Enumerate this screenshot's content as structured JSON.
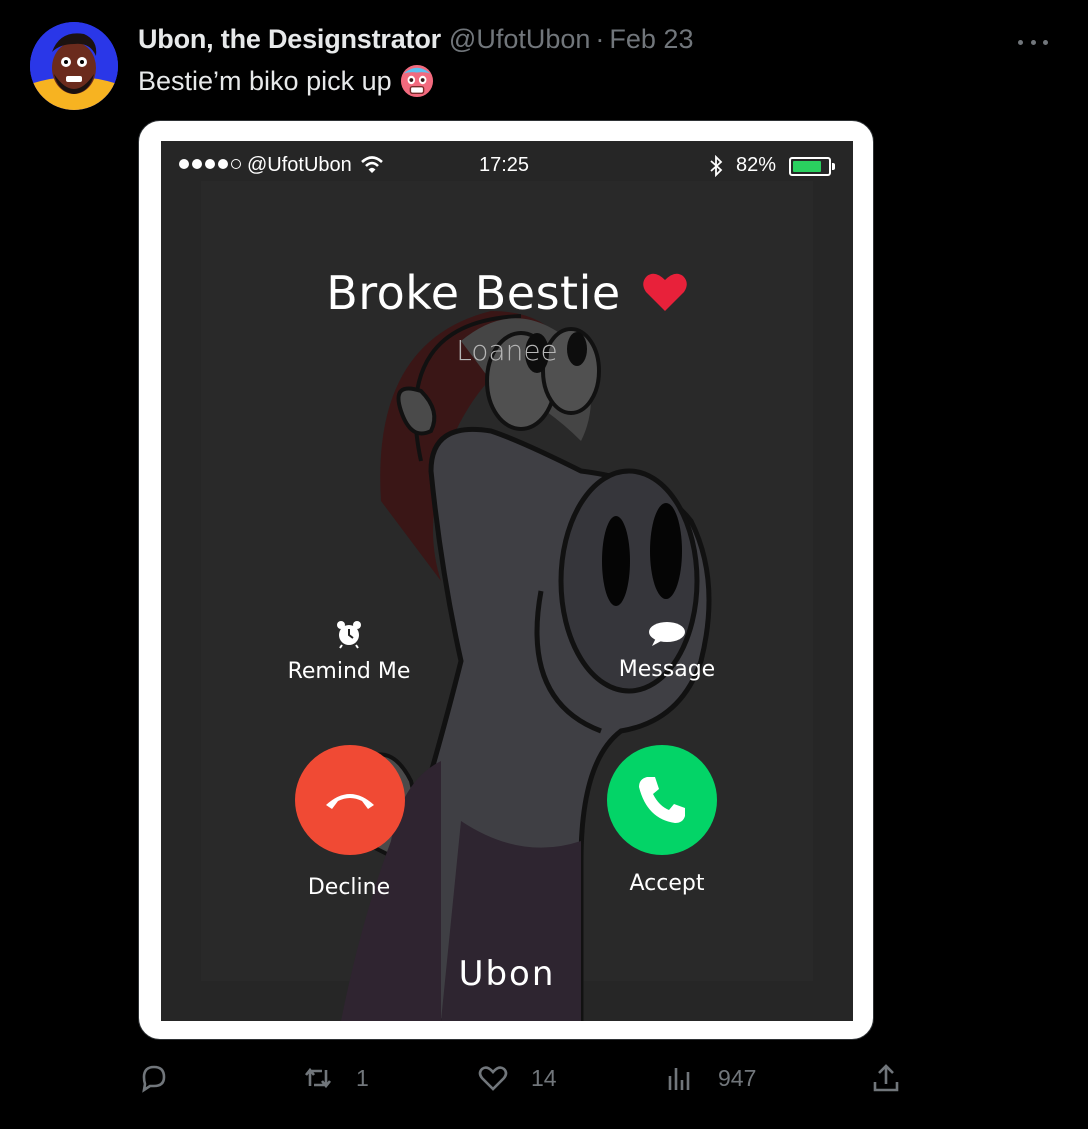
{
  "tweet": {
    "display_name": "Ubon, the Designstrator",
    "handle": "@UfotUbon",
    "separator": "·",
    "date": "Feb 23",
    "text": "Bestie’m biko pick up",
    "emoji": "hot-face-emoji"
  },
  "phone": {
    "status": {
      "carrier": "@UfotUbon",
      "time": "17:25",
      "battery_pct": "82%",
      "battery_level": 0.82
    },
    "caller_name": "Broke Bestie",
    "caller_sub": "Loanee",
    "remind_label": "Remind Me",
    "message_label": "Message",
    "decline_label": "Decline",
    "accept_label": "Accept",
    "brand": "Ubon"
  },
  "actions": {
    "retweets": "1",
    "likes": "14",
    "views": "947"
  },
  "colors": {
    "background": "#000000",
    "muted": "#71767b",
    "decline": "#f04a34",
    "accept": "#03d467",
    "heart": "#e8213a",
    "battery": "#2ad05f"
  }
}
